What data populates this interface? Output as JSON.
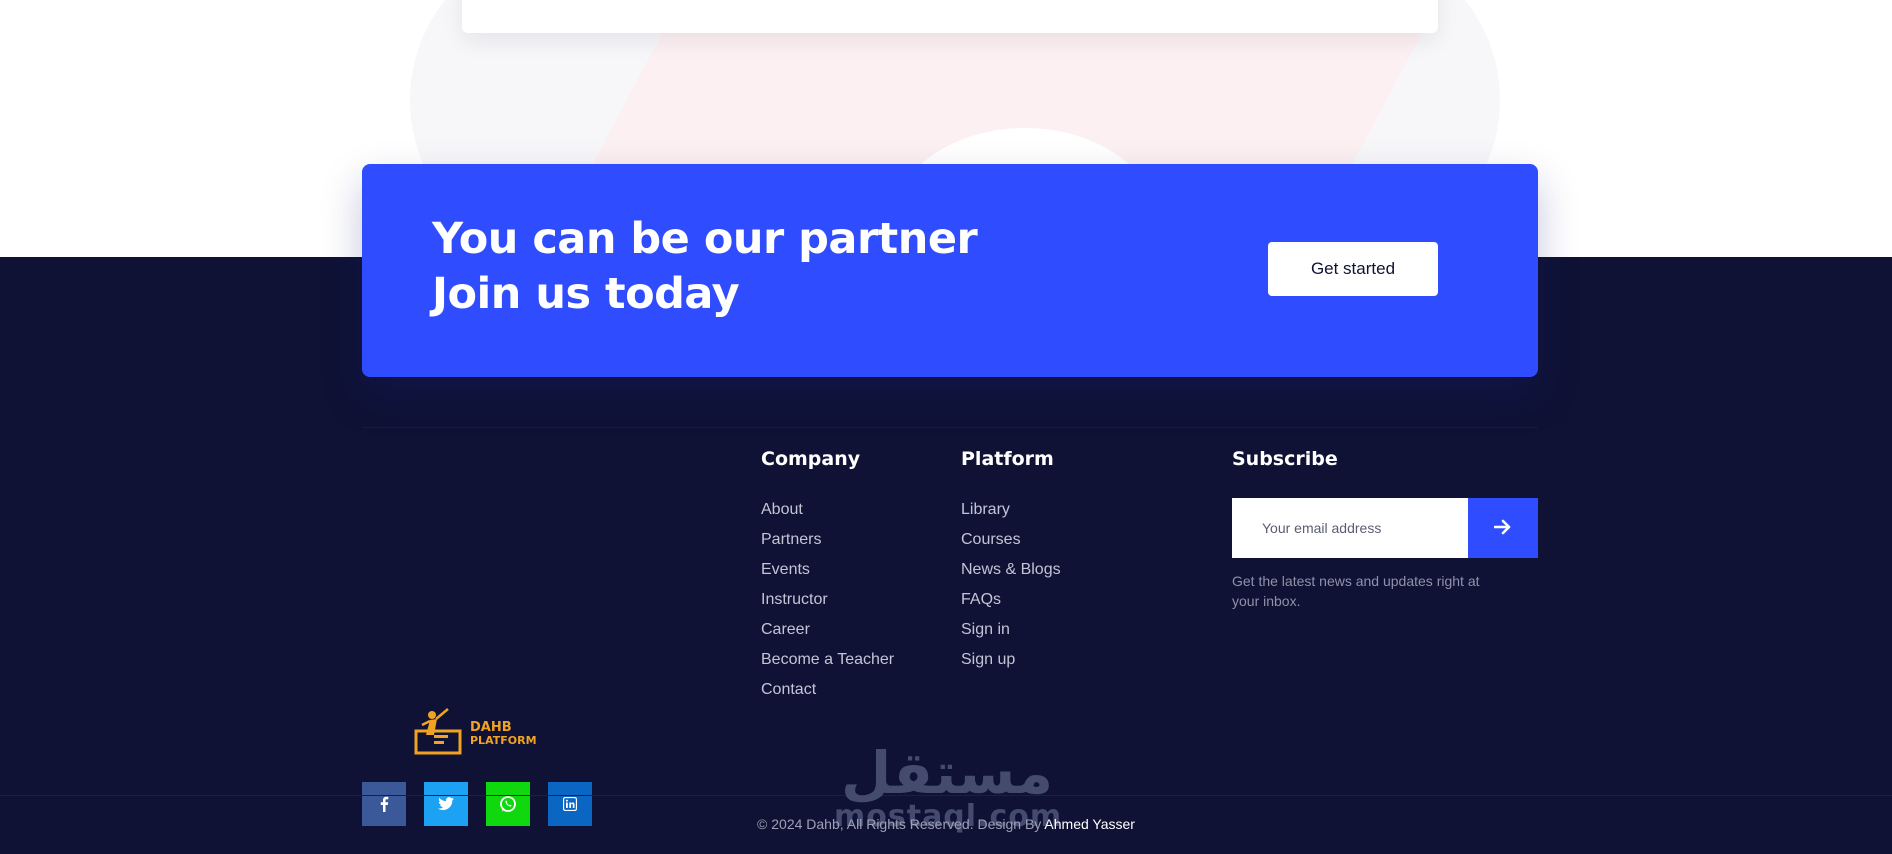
{
  "cta": {
    "line1": "You can be our partner",
    "line2": "Join us today",
    "button_label": "Get started"
  },
  "brand": {
    "logo_line1": "DAHB",
    "logo_line2": "PLATFORM"
  },
  "socials": [
    {
      "name": "facebook",
      "glyph": "f",
      "color": "#3b5998"
    },
    {
      "name": "twitter",
      "glyph": "t",
      "color": "#1da1f2"
    },
    {
      "name": "whatsapp",
      "glyph": "w",
      "color": "#0fd80f"
    },
    {
      "name": "linkedin",
      "glyph": "in",
      "color": "#0a66c2"
    }
  ],
  "company": {
    "title": "Company",
    "items": [
      "About",
      "Partners",
      "Events",
      "Instructor",
      "Career",
      "Become a Teacher",
      "Contact"
    ]
  },
  "platform": {
    "title": "Platform",
    "items": [
      "Library",
      "Courses",
      "News & Blogs",
      "FAQs",
      "Sign in",
      "Sign up"
    ]
  },
  "subscribe": {
    "title": "Subscribe",
    "placeholder": "Your email address",
    "note": "Get the latest news and updates right at your inbox."
  },
  "watermark": {
    "arabic": "مستقل",
    "latin": "mostaql.com"
  },
  "footer": {
    "copyright": "© 2024 Dahb, All Rights Reserved. Design By ",
    "author": "Ahmed Yasser"
  },
  "colors": {
    "accent": "#2f4dfe",
    "footer_bg": "#0f1235",
    "logo": "#f0a323"
  }
}
